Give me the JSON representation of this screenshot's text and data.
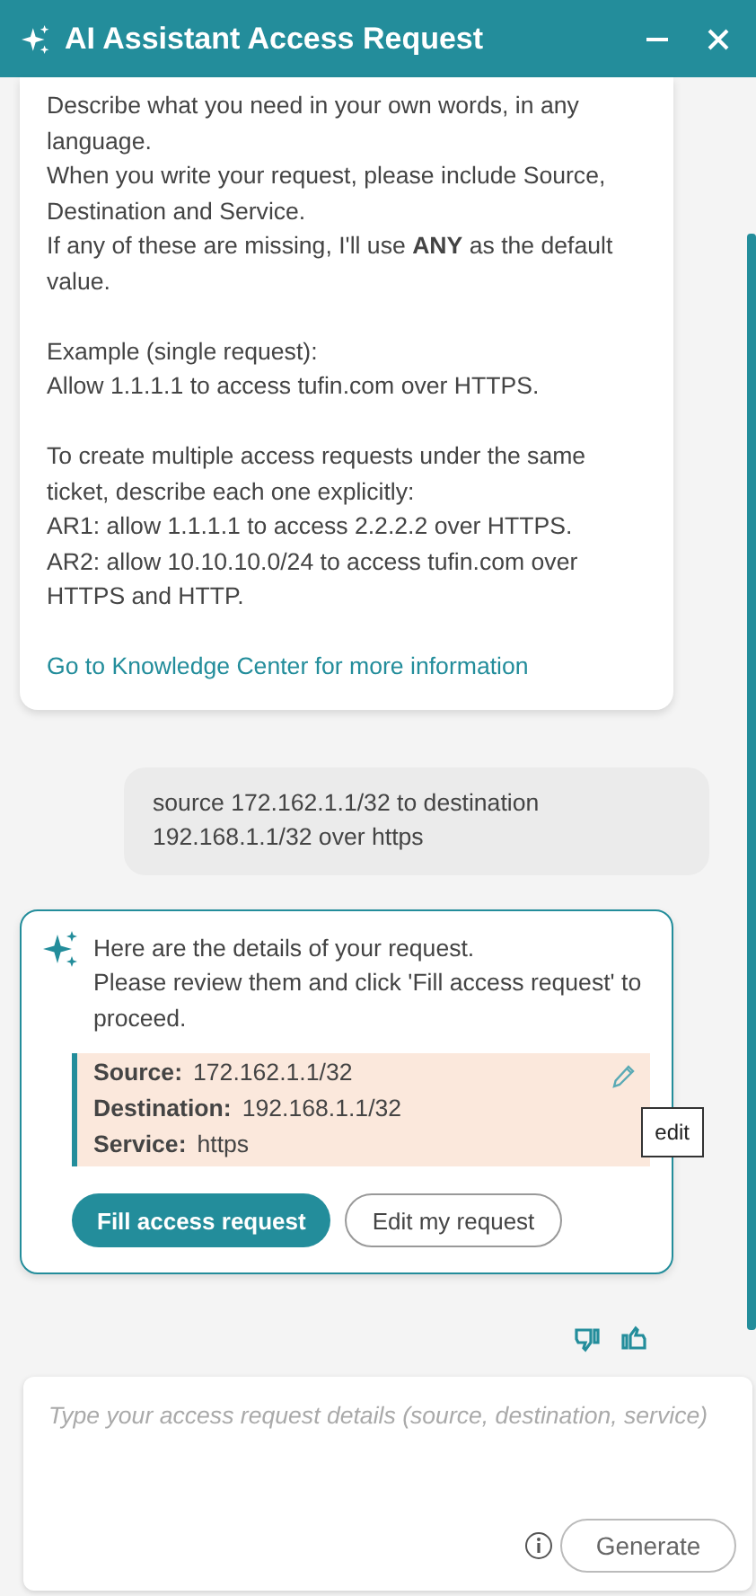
{
  "header": {
    "title": "AI Assistant Access Request"
  },
  "intro_message": {
    "paragraphs": [
      "Describe what you need in your own words, in any language.\nWhen you write your request, please include Source, Destination and Service.\nIf any of these are missing, I'll use **ANY** as the default value.",
      "Example (single request):\nAllow 1.1.1.1 to access tufin.com over HTTPS.",
      "To create multiple access requests under the same ticket, describe each one explicitly:\nAR1: allow 1.1.1.1 to access 2.2.2.2 over HTTPS.\nAR2: allow 10.10.10.0/24 to access tufin.com over HTTPS and HTTP."
    ],
    "link": "Go to Knowledge Center for more information"
  },
  "user_message": {
    "text": "source 172.162.1.1/32 to destination 192.168.1.1/32 over https"
  },
  "assistant_reply": {
    "text": "Here are the details of your request.\nPlease review them and click 'Fill access request' to proceed.",
    "details": [
      {
        "label": "Source:",
        "value": "172.162.1.1/32"
      },
      {
        "label": "Destination:",
        "value": "192.168.1.1/32"
      },
      {
        "label": "Service:",
        "value": "https"
      }
    ],
    "edit_tooltip": "edit",
    "buttons": [
      {
        "label": "Fill access request",
        "kind": "primary"
      },
      {
        "label": "Edit my request",
        "kind": "secondary"
      }
    ]
  },
  "composer": {
    "placeholder": "Type your access request details (source, destination, service)",
    "button": "Generate"
  }
}
